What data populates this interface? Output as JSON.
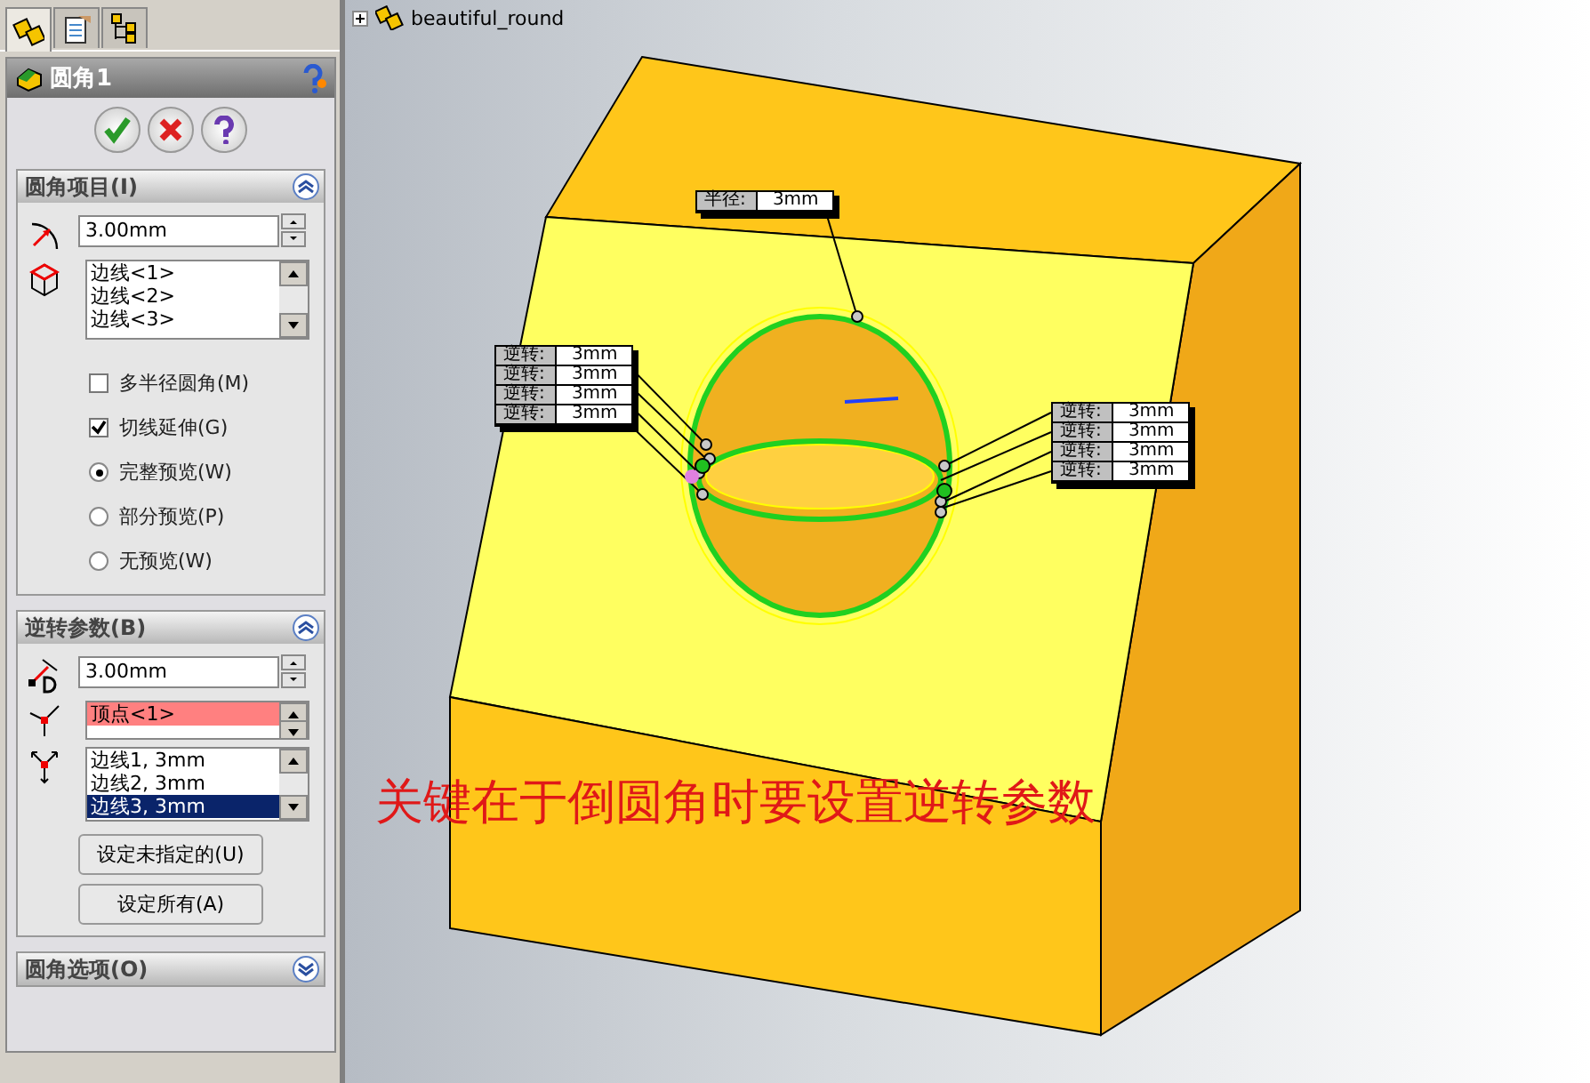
{
  "property_manager": {
    "tabs": [
      {
        "kind": "feature",
        "selected": true
      },
      {
        "kind": "property",
        "selected": false
      },
      {
        "kind": "config",
        "selected": false
      }
    ],
    "title": "圆角1",
    "fillet_items": {
      "title": "圆角项目(I)",
      "expanded": true,
      "radius": "3.00mm",
      "edges": [
        "边线<1>",
        "边线<2>",
        "边线<3>"
      ],
      "options": [
        {
          "kind": "checkbox",
          "label": "多半径圆角(M)",
          "checked": false
        },
        {
          "kind": "checkbox",
          "label": "切线延伸(G)",
          "checked": true
        },
        {
          "kind": "radio",
          "label": "完整预览(W)",
          "selected": true
        },
        {
          "kind": "radio",
          "label": "部分预览(P)",
          "selected": false
        },
        {
          "kind": "radio",
          "label": "无预览(W)",
          "selected": false
        }
      ]
    },
    "setback": {
      "title": "逆转参数(B)",
      "expanded": true,
      "distance": "3.00mm",
      "vertices": [
        {
          "text": "顶点<1>",
          "highlighted": true
        }
      ],
      "setbacks": [
        {
          "text": "边线1, 3mm",
          "selected": false
        },
        {
          "text": "边线2, 3mm",
          "selected": false
        },
        {
          "text": "边线3, 3mm",
          "selected": true
        }
      ],
      "buttons": [
        "设定未指定的(U)",
        "设定所有(A)"
      ]
    },
    "fillet_options": {
      "title": "圆角选项(O)",
      "expanded": false
    }
  },
  "viewport": {
    "tree_item": "beautiful_round",
    "callouts": [
      {
        "kind": "radius",
        "rows": [
          {
            "label": "半径:",
            "value": "3mm"
          }
        ]
      },
      {
        "kind": "setback_left",
        "rows": [
          {
            "label": "逆转:",
            "value": "3mm"
          },
          {
            "label": "逆转:",
            "value": "3mm"
          },
          {
            "label": "逆转:",
            "value": "3mm"
          },
          {
            "label": "逆转:",
            "value": "3mm"
          }
        ]
      },
      {
        "kind": "setback_right",
        "rows": [
          {
            "label": "逆转:",
            "value": "3mm"
          },
          {
            "label": "逆转:",
            "value": "3mm"
          },
          {
            "label": "逆转:",
            "value": "3mm"
          },
          {
            "label": "逆转:",
            "value": "3mm"
          }
        ]
      }
    ],
    "annotation": "关键在于倒圆角时要设置逆转参数"
  }
}
